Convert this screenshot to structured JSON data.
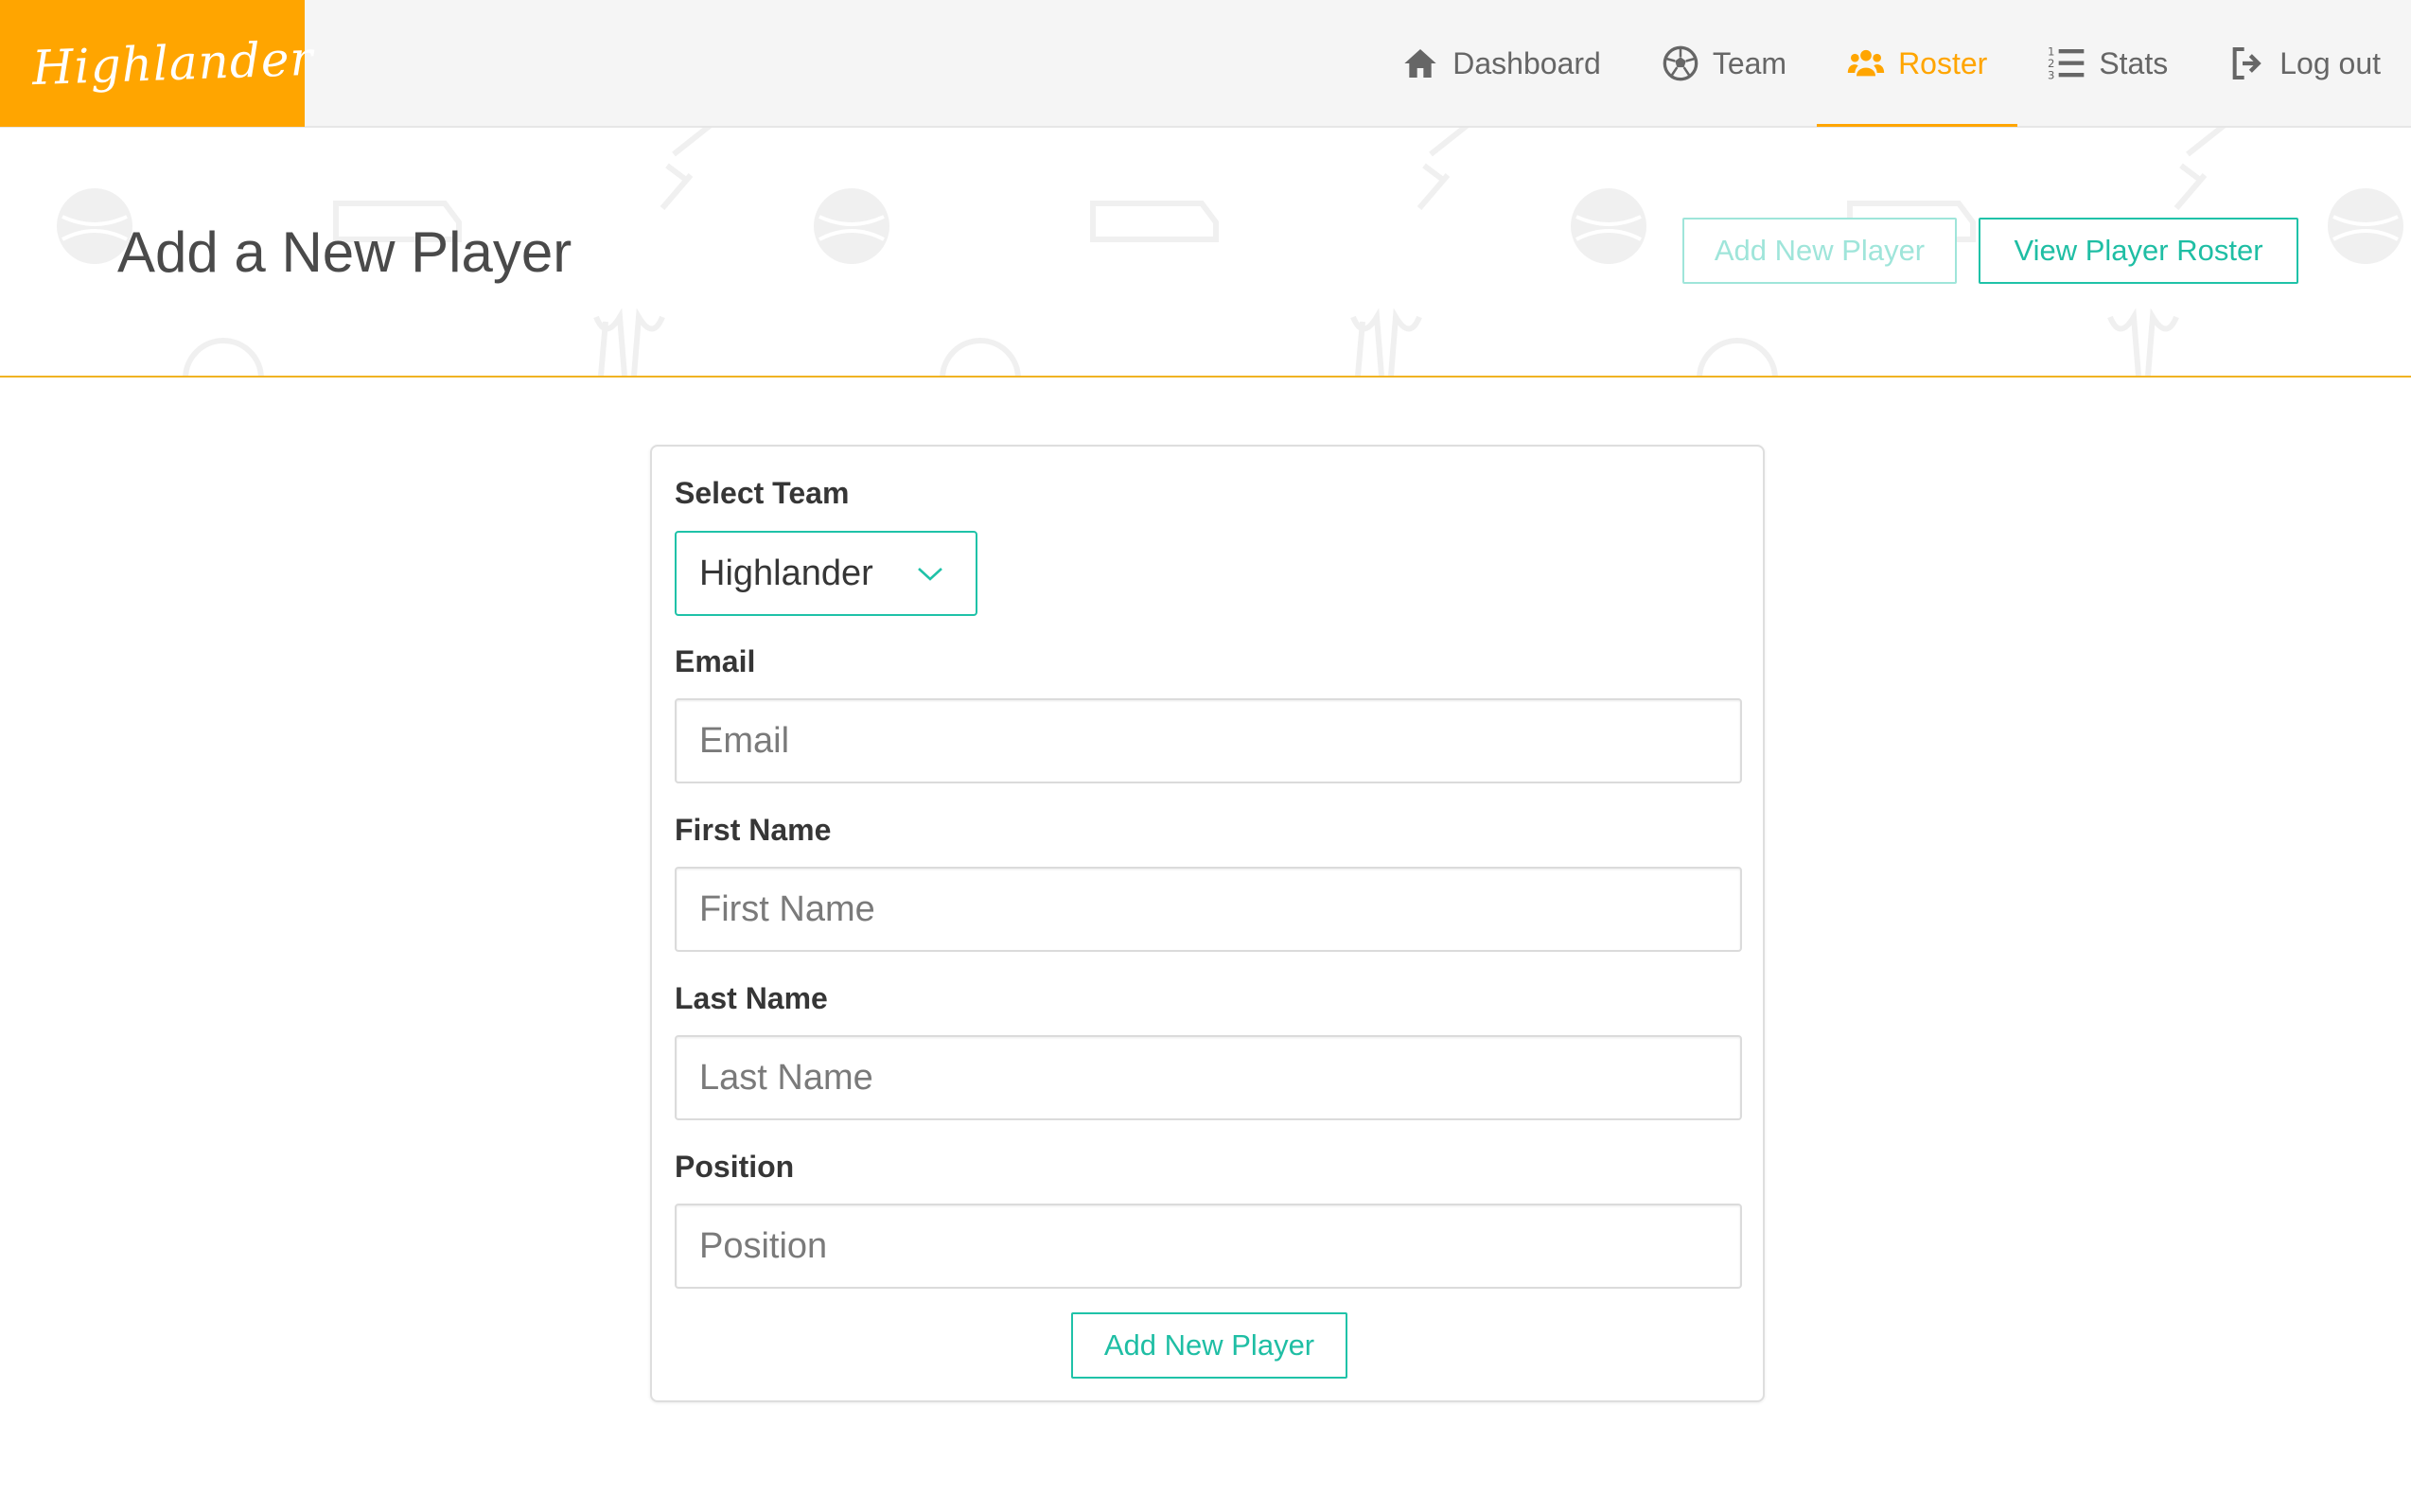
{
  "app": {
    "logo_text": "Highlander"
  },
  "nav": {
    "items": [
      {
        "label": "Dashboard",
        "icon": "home-icon"
      },
      {
        "label": "Team",
        "icon": "soccer-ball-icon"
      },
      {
        "label": "Roster",
        "icon": "users-icon",
        "active": true
      },
      {
        "label": "Stats",
        "icon": "list-ordered-icon"
      },
      {
        "label": "Log out",
        "icon": "sign-out-icon"
      }
    ]
  },
  "header": {
    "title": "Add a New Player",
    "add_button": "Add New Player",
    "roster_button": "View Player Roster"
  },
  "form": {
    "team_label": "Select Team",
    "team_value": "Highlander",
    "email_label": "Email",
    "email_placeholder": "Email",
    "first_name_label": "First Name",
    "first_name_placeholder": "First Name",
    "last_name_label": "Last Name",
    "last_name_placeholder": "Last Name",
    "position_label": "Position",
    "position_placeholder": "Position",
    "submit_label": "Add New Player"
  },
  "colors": {
    "brand": "#ffa500",
    "accent": "#1fc2a8",
    "banner_rule": "#f0b323"
  }
}
